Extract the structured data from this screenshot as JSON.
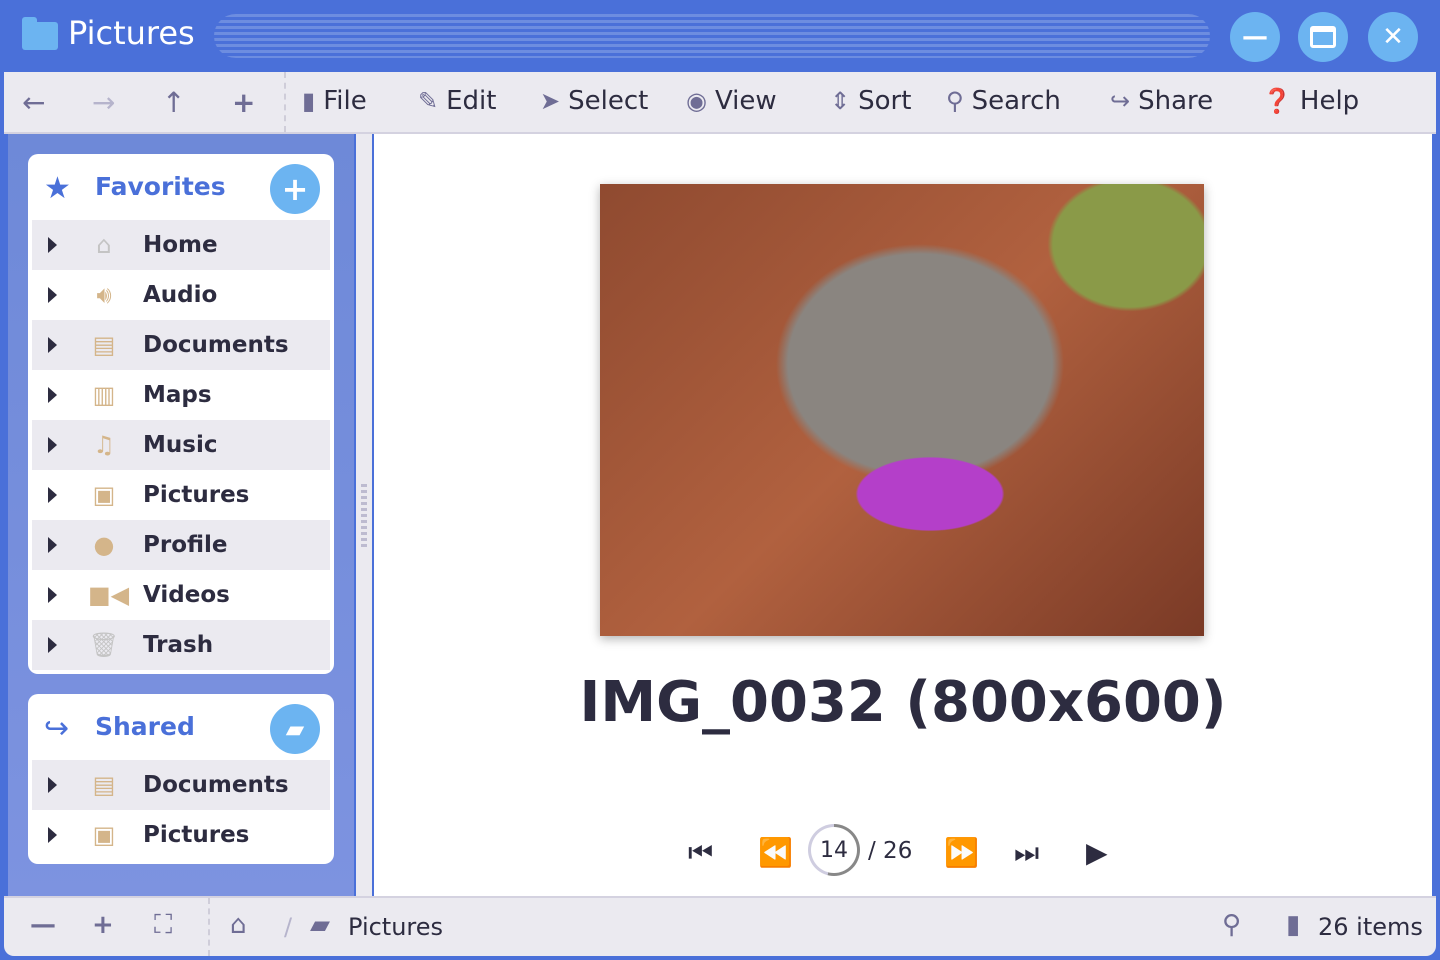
{
  "window": {
    "title": "Pictures",
    "minimize_icon": "minus",
    "maximize_icon": "window",
    "close_icon": "x"
  },
  "toolbar": {
    "nav": [
      "back",
      "forward",
      "up",
      "new"
    ],
    "menus": [
      {
        "label": "File",
        "icon": "file"
      },
      {
        "label": "Edit",
        "icon": "pencil"
      },
      {
        "label": "Select",
        "icon": "cursor"
      },
      {
        "label": "View",
        "icon": "eye"
      },
      {
        "label": "Sort",
        "icon": "sort"
      },
      {
        "label": "Search",
        "icon": "search"
      },
      {
        "label": "Share",
        "icon": "share"
      },
      {
        "label": "Help",
        "icon": "question"
      }
    ]
  },
  "sidebar": {
    "favorites": {
      "title": "Favorites",
      "items": [
        {
          "label": "Home"
        },
        {
          "label": "Audio"
        },
        {
          "label": "Documents"
        },
        {
          "label": "Maps"
        },
        {
          "label": "Music"
        },
        {
          "label": "Pictures"
        },
        {
          "label": "Profile"
        },
        {
          "label": "Videos"
        },
        {
          "label": "Trash"
        }
      ]
    },
    "shared": {
      "title": "Shared",
      "items": [
        {
          "label": "Documents"
        },
        {
          "label": "Pictures"
        }
      ]
    }
  },
  "viewer": {
    "caption": "IMG_0032 (800x600)",
    "current": "14",
    "total": "/ 26",
    "progress_percent": 54
  },
  "status": {
    "breadcrumb_sep": "/",
    "folder": "Pictures",
    "count": "26 items"
  },
  "colors": {
    "accent": "#4a70d9",
    "light_accent": "#6cb4f1",
    "text": "#2d2c40"
  }
}
